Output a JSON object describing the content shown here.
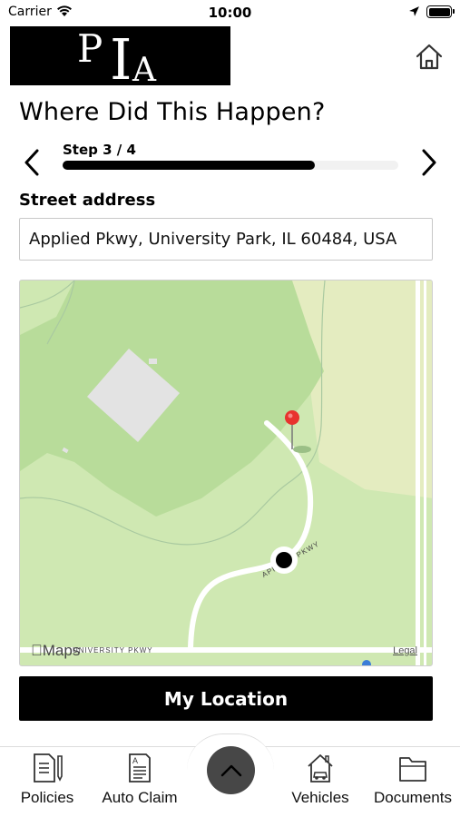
{
  "status_bar": {
    "carrier": "Carrier",
    "time": "10:00"
  },
  "header": {
    "logo_letters": [
      "P",
      "I",
      "A"
    ]
  },
  "page": {
    "title": "Where Did This Happen?"
  },
  "steps": {
    "label": "Step 3 / 4",
    "current": 3,
    "total": 4,
    "progress_fraction": 0.75
  },
  "address": {
    "label": "Street address",
    "value": "Applied Pkwy, University Park, IL 60484, USA"
  },
  "map": {
    "attribution": "Maps",
    "legal": "Legal",
    "street_labels": [
      "APPLIED PKWY",
      "UNIVERSITY PKWY"
    ],
    "colors": {
      "park": "#cfe8b2",
      "forest": "#b8dc9a",
      "building": "#e3e3e3",
      "road": "#ffffff",
      "pin": "#e8322e"
    }
  },
  "actions": {
    "my_location": "My Location"
  },
  "tabs": [
    {
      "label": "Policies",
      "icon": "document-pen-icon"
    },
    {
      "label": "Auto Claim",
      "icon": "claim-form-icon"
    },
    {
      "label": "Vehicles",
      "icon": "house-car-icon"
    },
    {
      "label": "Documents",
      "icon": "folder-icon"
    }
  ]
}
